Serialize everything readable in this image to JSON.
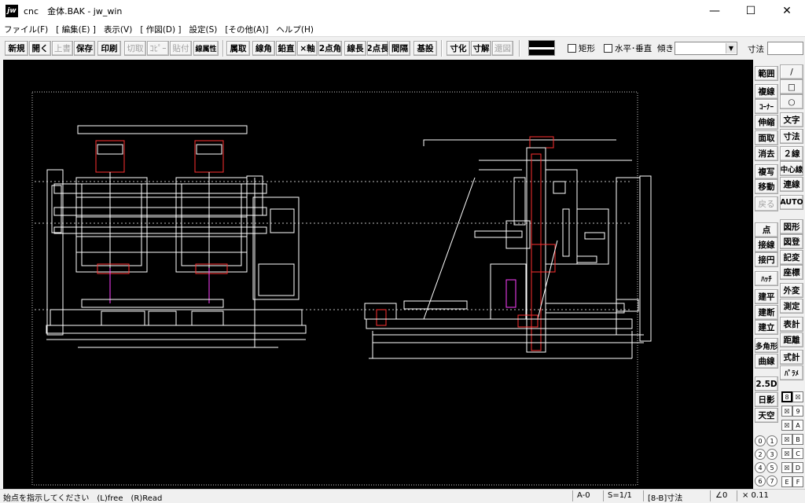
{
  "window": {
    "icon_text": "jw",
    "title": "cnc　金体.BAK - jw_win",
    "minimize": "—",
    "maximize": "☐",
    "close": "✕"
  },
  "menu": [
    "ファイル(F)",
    "[ 編集(E) ]",
    "表示(V)",
    "[ 作図(D) ]",
    "設定(S)",
    "[その他(A)]",
    "ヘルプ(H)"
  ],
  "toolbar": {
    "new": "新規",
    "open": "開く",
    "overwrite": "上書",
    "save": "保存",
    "print": "印刷",
    "cut": "切取",
    "copy": "ｺﾋﾟｰ",
    "paste": "貼付",
    "linetype": "線属性",
    "attribute": "属取",
    "line_angle": "線角",
    "vertical": "鉛直",
    "x_axis": "×軸",
    "two_point_angle": "2点角",
    "line_length": "線長",
    "two_point_length": "2点長",
    "interval": "間隔",
    "base_setting": "基設",
    "dimension": "寸化",
    "dim_release": "寸解",
    "trace": "還図",
    "rect_label": "矩形",
    "hv_label": "水平･垂直",
    "tilt_label": "傾き",
    "dim_label": "寸法"
  },
  "right_panel": {
    "col1": [
      "範囲",
      "複線",
      "ｺｰﾅｰ",
      "伸縮",
      "面取",
      "消去",
      "複写",
      "移動",
      "戻る",
      "点",
      "接線",
      "接円",
      "ﾊｯﾁ",
      "建平",
      "建断",
      "建立",
      "多角形",
      "曲線",
      "2.5D",
      "日影",
      "天空"
    ],
    "col2": [
      "/",
      "□",
      "○",
      "文字",
      "寸法",
      "２線",
      "中心線",
      "連線",
      "AUTO",
      "図形",
      "図登",
      "記変",
      "座標",
      "外変",
      "測定",
      "表計",
      "距離",
      "式計",
      "ﾊﾟﾗﾒ"
    ],
    "layer_groups": [
      "8",
      "9",
      "A",
      "B",
      "C",
      "D",
      "E",
      "F"
    ],
    "layers": [
      "0",
      "1",
      "2",
      "3",
      "4",
      "5",
      "6",
      "7"
    ]
  },
  "status": {
    "message": "始点を指示してください　(L)free　(R)Read",
    "layer": "A-0",
    "scale": "S=1/1",
    "mode": "[8-B]寸法",
    "angle": "∠0",
    "multiplier": "× 0.11"
  },
  "colors": {
    "canvas_bg": "#000000",
    "line_white": "#ffffff",
    "line_red": "#ff3030",
    "line_magenta": "#ff40ff",
    "line_gray": "#c0c0c0"
  }
}
